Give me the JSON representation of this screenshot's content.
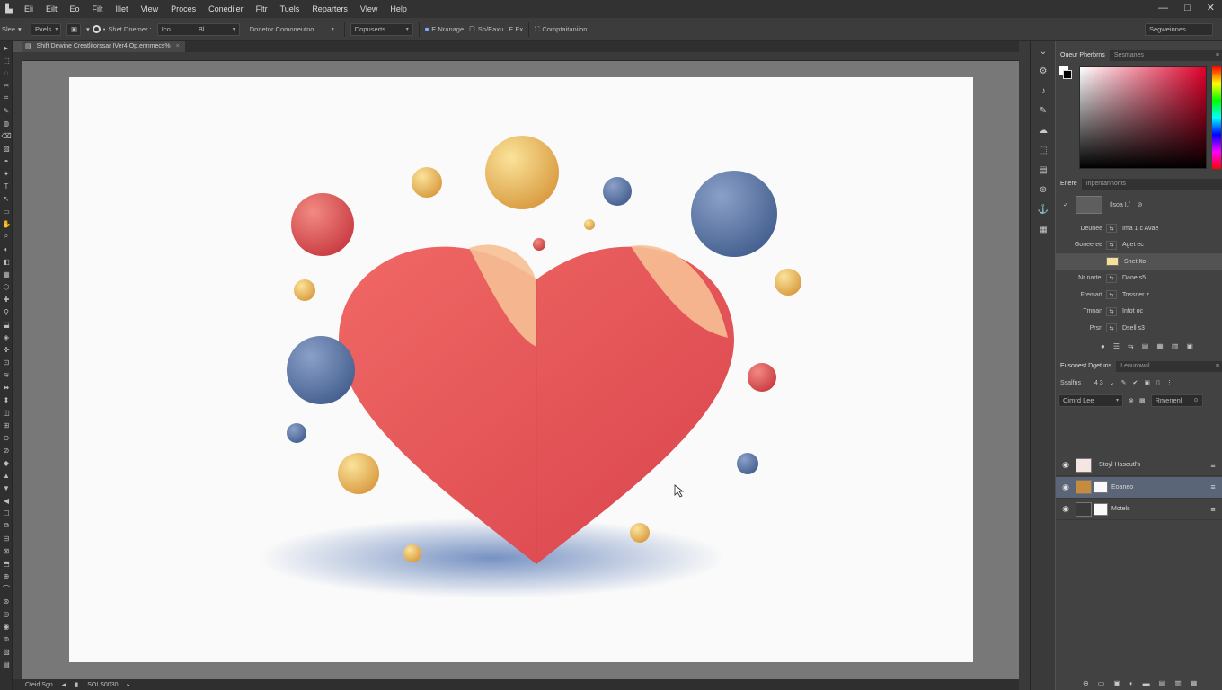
{
  "menubar": {
    "app_icon": "ps-logo-icon",
    "items": [
      "Eli",
      "Eilt",
      "Eo",
      "Filt",
      "Iliet",
      "Vlew",
      "Proces",
      "Conediler",
      "Fltr",
      "Tuels",
      "Reparters",
      "Vlew",
      "Help"
    ],
    "window_controls": [
      "—",
      "□",
      "✕"
    ]
  },
  "options": {
    "preset": "Slee",
    "mode": "Pxels",
    "dropdown_1": "Shet Dnemer :",
    "size_a": "Ico",
    "size_b": "Bl",
    "sample": "Donetor Comoneutno...",
    "blend": "Dopuserts",
    "check_1": "E Nranage",
    "check_2": "Sh/Eaxu",
    "check_3": "E.Ex",
    "action": "Comptaitaniion",
    "workspace": "Segweinnes"
  },
  "document": {
    "tab_title": "Shift Dewine Creatlitorssar IVer4 Op.ennmecs%",
    "close": "×"
  },
  "status": {
    "zoom": "Cteid Sgn",
    "doc_size": "SOLS0030"
  },
  "panels": {
    "color": {
      "tabs": [
        "Oueur Pherbrns",
        "Sesmanes"
      ],
      "fg_color": "#000000",
      "bg_color": "#ffffff"
    },
    "properties": {
      "tabs": [
        "Enere",
        "Inpentannorits"
      ],
      "header_label": "Ilsoa I./",
      "rows": [
        {
          "label": "Deunee",
          "value": "Ima  1 c  Avae"
        },
        {
          "label": "Goneeree",
          "value": "Aget ec"
        },
        {
          "label": "",
          "value": "Shet Ito",
          "chip": "#f4e098"
        },
        {
          "label": "Nr nartel",
          "value": "Dane s5"
        },
        {
          "label": "Fremart",
          "value": "Tossner z"
        },
        {
          "label": "Tmnan",
          "value": "Infot oc"
        },
        {
          "label": "Prsn",
          "value": "Dsell s3"
        }
      ]
    },
    "layers": {
      "tabs": [
        "Eusonest Dgetuns",
        "Lenurowal"
      ],
      "filter_label": "Ssalfns",
      "filter_value": "4 3",
      "mode": "Cimrd Lee",
      "opacity": "Rmenenl",
      "items": [
        {
          "name": "Stoyl Haseutl's",
          "selected": false
        },
        {
          "name": "Eoaneo",
          "selected": true
        },
        {
          "name": "Motels",
          "selected": false
        }
      ]
    }
  },
  "artwork": {
    "heart_color": "#e8575a",
    "accent_blue": "#5d78a8",
    "accent_yellow": "#eec06a"
  }
}
